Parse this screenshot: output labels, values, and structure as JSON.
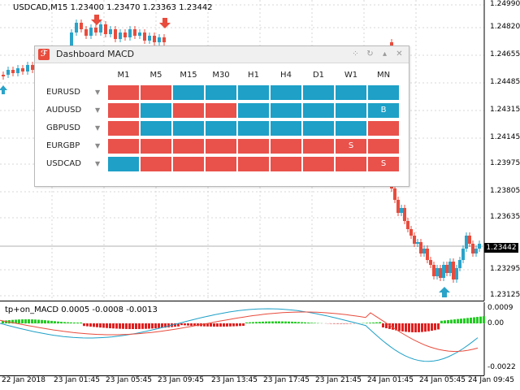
{
  "chart": {
    "symbol_title": "USDCAD,M15  1.23400 1.23470 1.23363 1.23442",
    "price_labels": [
      "1.24990",
      "1.24820",
      "1.24655",
      "1.24485",
      "1.24315",
      "1.24145",
      "1.23975",
      "1.23805",
      "1.23635",
      "1.23442",
      "1.23295",
      "1.23125"
    ],
    "current_price": "1.23442",
    "time_labels": [
      "22 Jan 2018",
      "23 Jan 01:45",
      "23 Jan 05:45",
      "23 Jan 09:45",
      "23 Jan 13:45",
      "23 Jan 17:45",
      "23 Jan 21:45",
      "24 Jan 01:45",
      "24 Jan 05:45",
      "24 Jan 09:45"
    ],
    "colors": {
      "bull": "#2aa3c9",
      "bear": "#e84c3d"
    }
  },
  "oscillator": {
    "title": "tp+on_MACD 0.0005 -0.0008 -0.0013",
    "labels": [
      "0.0009",
      "0.00",
      "-0.0022"
    ]
  },
  "dashboard": {
    "title": "Dashboard MACD",
    "logo_icon": "dashboard-logo-icon",
    "header_icons": [
      "grid-icon",
      "refresh-icon",
      "collapse-icon",
      "close-icon"
    ],
    "timeframes": [
      "M1",
      "M5",
      "M15",
      "M30",
      "H1",
      "H4",
      "D1",
      "W1",
      "MN"
    ],
    "rows": [
      {
        "symbol": "EURUSD",
        "cells": [
          "r",
          "r",
          "b",
          "b",
          "b",
          "b",
          "b",
          "b",
          "b"
        ],
        "marks": [
          "",
          "",
          "",
          "",
          "",
          "",
          "",
          "",
          ""
        ]
      },
      {
        "symbol": "AUDUSD",
        "cells": [
          "r",
          "b",
          "r",
          "r",
          "b",
          "b",
          "b",
          "b",
          "b"
        ],
        "marks": [
          "",
          "",
          "",
          "",
          "",
          "",
          "",
          "",
          "B"
        ]
      },
      {
        "symbol": "GBPUSD",
        "cells": [
          "r",
          "b",
          "b",
          "b",
          "b",
          "b",
          "b",
          "b",
          "r"
        ],
        "marks": [
          "",
          "",
          "",
          "",
          "",
          "",
          "",
          "",
          ""
        ]
      },
      {
        "symbol": "EURGBP",
        "cells": [
          "r",
          "r",
          "r",
          "r",
          "r",
          "r",
          "r",
          "r",
          "r"
        ],
        "marks": [
          "",
          "",
          "",
          "",
          "",
          "",
          "",
          "S",
          ""
        ]
      },
      {
        "symbol": "USDCAD",
        "cells": [
          "b",
          "r",
          "r",
          "r",
          "r",
          "r",
          "r",
          "r",
          "r"
        ],
        "marks": [
          "",
          "",
          "",
          "",
          "",
          "",
          "",
          "",
          "S"
        ]
      }
    ],
    "colors": {
      "red": "#e9514b",
      "blue": "#1ea0c7"
    }
  }
}
